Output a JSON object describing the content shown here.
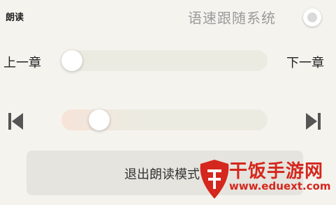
{
  "header": {
    "title": "朗读",
    "follow_label": "语速跟随系统",
    "follow_enabled": false
  },
  "chapter_slider": {
    "prev_label": "上一章",
    "next_label": "下一章",
    "progress": 0.0
  },
  "track_slider": {
    "progress": 0.18
  },
  "icons": {
    "prev": "skip-previous-icon",
    "next": "skip-next-icon"
  },
  "exit_button": {
    "label": "退出朗读模式"
  },
  "watermark": {
    "title": "干饭手游网",
    "url": "www.eduext.com"
  },
  "colors": {
    "accent": "#d4271d",
    "track": "#ecebe1",
    "background": "#f5f3ee"
  }
}
